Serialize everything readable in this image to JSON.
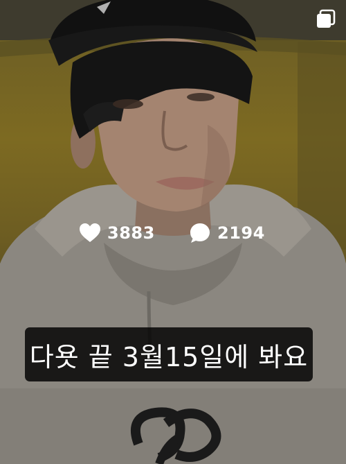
{
  "post": {
    "likes_count": "3883",
    "comments_count": "2194",
    "caption": "다욧 끝 3월15일에 봐요"
  },
  "icons": {
    "likes": "heart-icon",
    "comments": "comment-bubble-icon",
    "multi_post": "multiple-photos-icon"
  },
  "colors": {
    "overlay_text": "#ffffff",
    "caption_background": "#000000"
  }
}
